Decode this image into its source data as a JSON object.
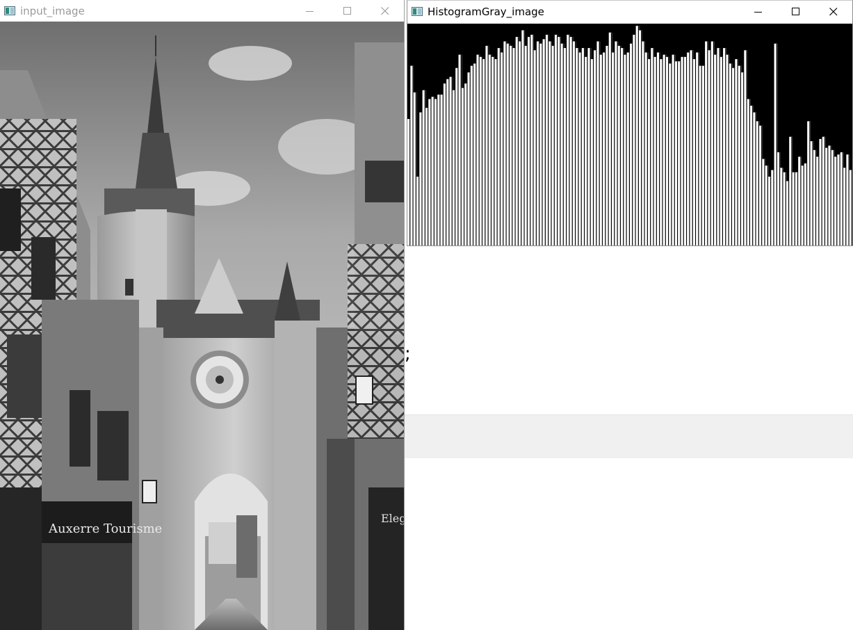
{
  "windows": {
    "input": {
      "title": "input_image",
      "photo_content": {
        "sign_text": "Auxerre Tourisme",
        "shop_sign_text": "Elegan"
      }
    },
    "histogram": {
      "title": "HistogramGray_image",
      "bar_color": "#ffffff",
      "background_color": "#000000",
      "chart_data": {
        "type": "bar",
        "description": "Grayscale intensity histogram, values relative to window height (0-1)",
        "values": [
          0.57,
          0.81,
          0.69,
          0.31,
          0.6,
          0.7,
          0.62,
          0.66,
          0.67,
          0.66,
          0.68,
          0.68,
          0.73,
          0.75,
          0.76,
          0.7,
          0.8,
          0.86,
          0.71,
          0.73,
          0.78,
          0.81,
          0.82,
          0.86,
          0.85,
          0.84,
          0.9,
          0.86,
          0.85,
          0.84,
          0.89,
          0.87,
          0.92,
          0.91,
          0.9,
          0.89,
          0.94,
          0.92,
          0.97,
          0.9,
          0.94,
          0.95,
          0.88,
          0.92,
          0.91,
          0.93,
          0.95,
          0.92,
          0.9,
          0.95,
          0.94,
          0.91,
          0.89,
          0.95,
          0.94,
          0.92,
          0.89,
          0.87,
          0.89,
          0.85,
          0.89,
          0.84,
          0.88,
          0.92,
          0.86,
          0.87,
          0.9,
          0.96,
          0.87,
          0.92,
          0.9,
          0.89,
          0.86,
          0.87,
          0.91,
          0.95,
          0.99,
          0.97,
          0.92,
          0.87,
          0.84,
          0.89,
          0.85,
          0.87,
          0.84,
          0.86,
          0.85,
          0.82,
          0.86,
          0.83,
          0.83,
          0.85,
          0.85,
          0.87,
          0.88,
          0.84,
          0.87,
          0.81,
          0.81,
          0.92,
          0.88,
          0.92,
          0.86,
          0.89,
          0.85,
          0.89,
          0.86,
          0.82,
          0.8,
          0.84,
          0.81,
          0.78,
          0.88,
          0.66,
          0.63,
          0.6,
          0.56,
          0.54,
          0.39,
          0.36,
          0.31,
          0.34,
          0.91,
          0.42,
          0.35,
          0.33,
          0.29,
          0.49,
          0.33,
          0.33,
          0.4,
          0.36,
          0.37,
          0.56,
          0.47,
          0.43,
          0.4,
          0.48,
          0.49,
          0.44,
          0.45,
          0.43,
          0.4,
          0.41,
          0.42,
          0.35,
          0.41,
          0.34
        ]
      }
    }
  },
  "controls": {
    "minimize": "minimize",
    "maximize": "maximize",
    "close": "close"
  },
  "background": {
    "stray_text": ";"
  }
}
